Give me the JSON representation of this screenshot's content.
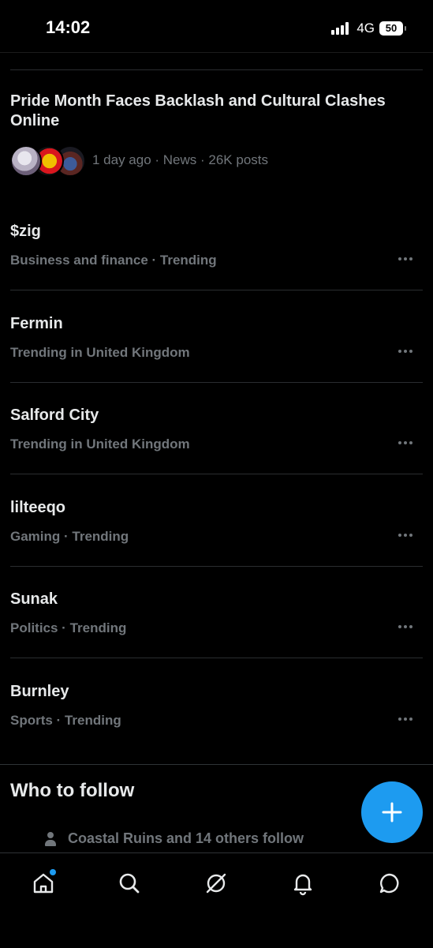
{
  "status_bar": {
    "time": "14:02",
    "network": "4G",
    "battery": "50"
  },
  "news": {
    "title": "Pride Month Faces Backlash and Cultural Clashes Online",
    "meta": "1 day ago · News · 26K posts"
  },
  "trends": [
    {
      "title": "$zig",
      "subtitle": "Business and finance · Trending"
    },
    {
      "title": "Fermin",
      "subtitle": "Trending in United Kingdom"
    },
    {
      "title": "Salford City",
      "subtitle": "Trending in United Kingdom"
    },
    {
      "title": "lilteeqo",
      "subtitle": "Gaming · Trending"
    },
    {
      "title": "Sunak",
      "subtitle": "Politics · Trending"
    },
    {
      "title": "Burnley",
      "subtitle": "Sports · Trending"
    }
  ],
  "who_to_follow": {
    "title": "Who to follow",
    "social_proof": "Coastal Ruins and 14 others follow"
  },
  "colors": {
    "accent": "#1d9bf0",
    "background": "#000000",
    "secondary_text": "#71767b"
  },
  "icons": {
    "nav": [
      "home-icon",
      "search-icon",
      "grok-icon",
      "notifications-icon",
      "messages-icon"
    ],
    "fab": "plus-icon"
  }
}
